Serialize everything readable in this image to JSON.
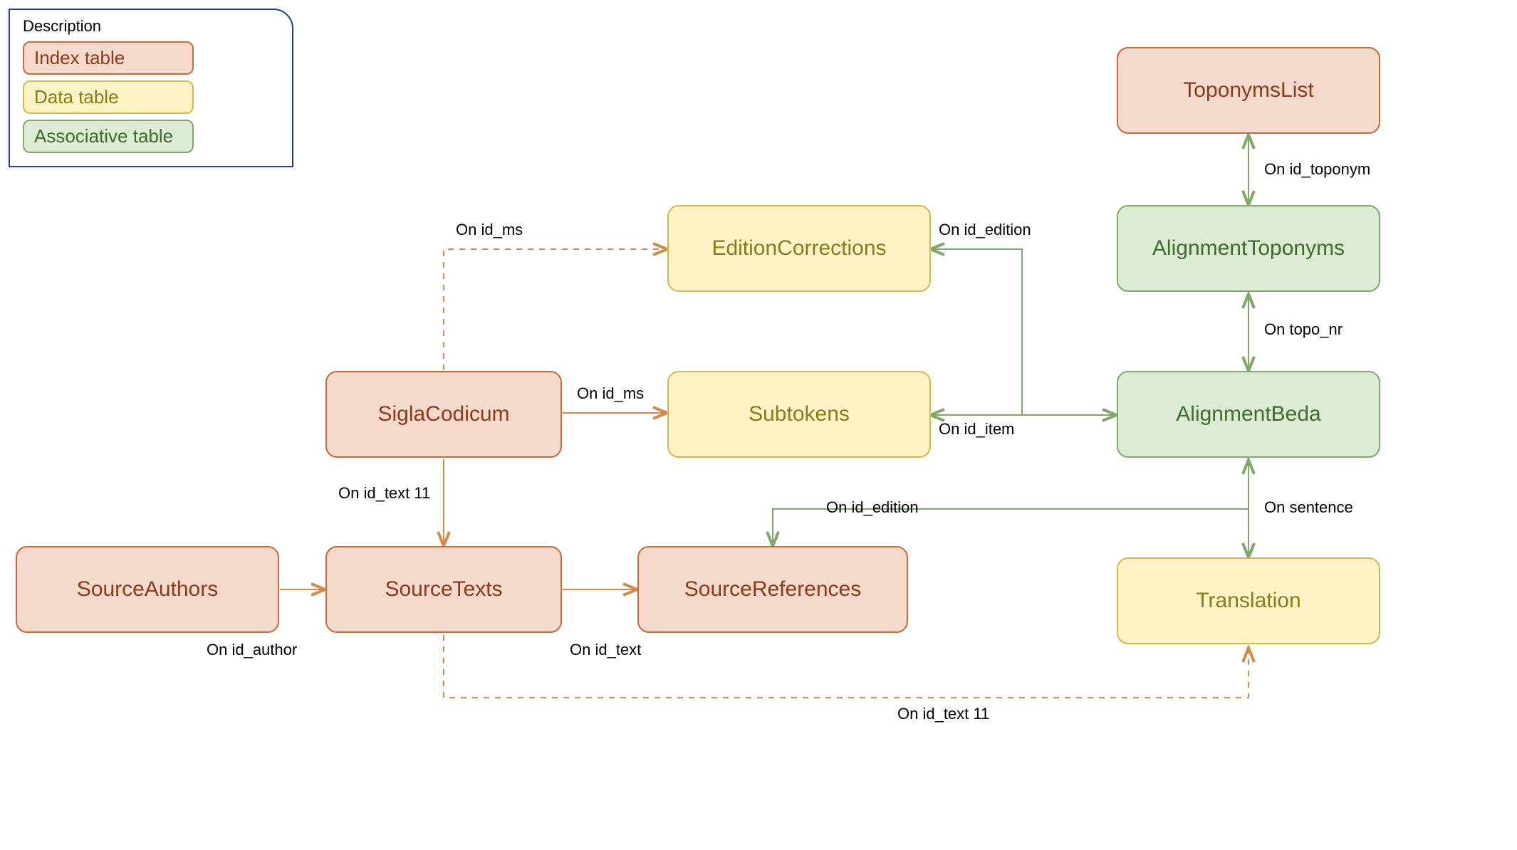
{
  "legend": {
    "title": "Description",
    "items": {
      "index": "Index table",
      "data": "Data table",
      "assoc": "Associative table"
    }
  },
  "nodes": {
    "toponymsList": "ToponymsList",
    "alignmentToponyms": "AlignmentToponyms",
    "alignmentBeda": "AlignmentBeda",
    "translation": "Translation",
    "editionCorrections": "EditionCorrections",
    "subtokens": "Subtokens",
    "siglaCodicum": "SiglaCodicum",
    "sourceAuthors": "SourceAuthors",
    "sourceTexts": "SourceTexts",
    "sourceReferences": "SourceReferences"
  },
  "edges": {
    "on_id_toponym": "On id_toponym",
    "on_topo_nr": "On topo_nr",
    "on_sentence": "On sentence",
    "on_id_edition_top": "On id_edition",
    "on_id_edition_mid": "On id_edition",
    "on_id_item": "On id_item",
    "on_id_ms_solid": "On id_ms",
    "on_id_ms_dashed": "On id_ms",
    "on_id_text_11_top": "On id_text 11",
    "on_id_text_11_bottom": "On id_text 11",
    "on_id_author": "On id_author",
    "on_id_text": "On id_text"
  },
  "colors": {
    "index_fill": "#f5d9cd",
    "index_border": "#c66a3a",
    "index_text": "#8b3a1a",
    "data_fill": "#fdf3c4",
    "data_border": "#d6b94a",
    "data_text": "#8a7a1a",
    "assoc_fill": "#dcecd4",
    "assoc_border": "#7fa86a",
    "assoc_text": "#3f6b2f",
    "legend_border": "#1f3fa6",
    "conn_orange": "#d68a4a",
    "conn_green": "#7fa86a"
  }
}
